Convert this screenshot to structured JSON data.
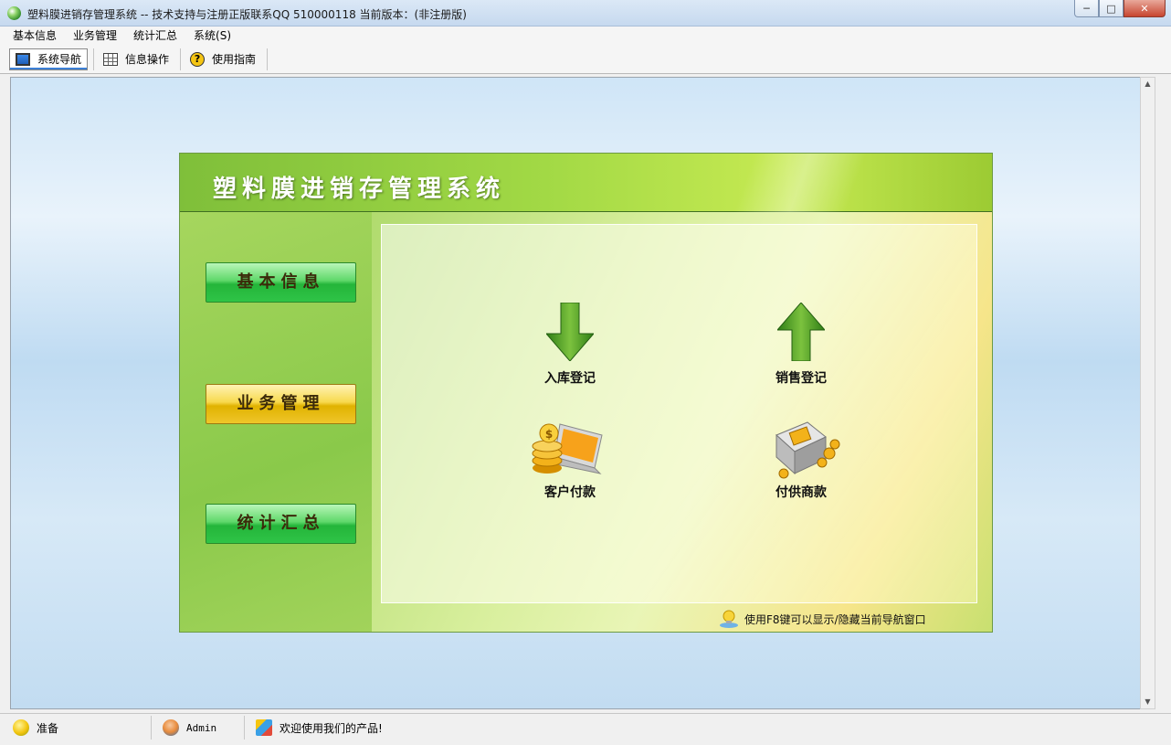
{
  "window": {
    "title": "塑料膜进销存管理系统 -- 技术支持与注册正版联系QQ 510000118    当前版本：(非注册版)",
    "controls": {
      "minimize": "─",
      "maximize": "□",
      "close": "✕"
    }
  },
  "menu": [
    "基本信息",
    "业务管理",
    "统计汇总",
    "系统(S)"
  ],
  "toolbar": [
    {
      "label": "系统导航",
      "icon": "monitor-icon",
      "active": true
    },
    {
      "label": "信息操作",
      "icon": "grid-icon",
      "active": false
    },
    {
      "label": "使用指南",
      "icon": "help-icon",
      "active": false
    }
  ],
  "panel": {
    "title": "塑料膜进销存管理系统",
    "side_buttons": [
      "基本信息",
      "业务管理",
      "统计汇总"
    ],
    "active_side_button": "业务管理",
    "items": [
      {
        "label": "入库登记",
        "icon": "arrow-down-icon"
      },
      {
        "label": "销售登记",
        "icon": "arrow-up-icon"
      },
      {
        "label": "客户付款",
        "icon": "coins-laptop-icon"
      },
      {
        "label": "付供商款",
        "icon": "coins-safe-icon"
      }
    ],
    "hint": "使用F8键可以显示/隐藏当前导航窗口"
  },
  "status": {
    "state": "准备",
    "user": "Admin",
    "message": "欢迎使用我们的产品!"
  },
  "colors": {
    "header_green": "#a2d945",
    "button_green": "#24b53a",
    "button_gold": "#e0b200",
    "arrow_green": "#3f8f1f"
  }
}
